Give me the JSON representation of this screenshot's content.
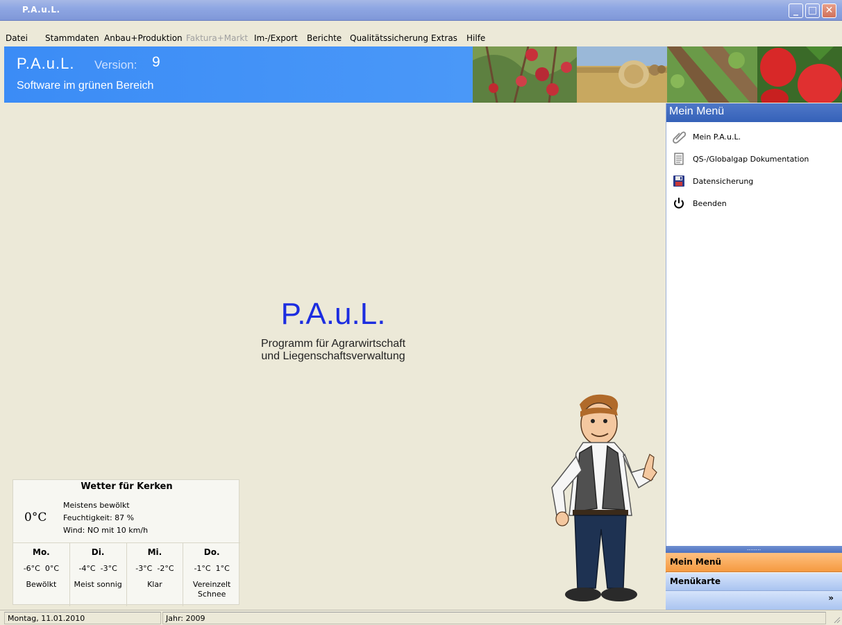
{
  "window": {
    "title": "P.A.u.L."
  },
  "menu": [
    {
      "label": "Datei",
      "enabled": true
    },
    {
      "label": "Stammdaten",
      "enabled": true
    },
    {
      "label": "Anbau+Produktion",
      "enabled": true
    },
    {
      "label": "Faktura+Markt",
      "enabled": false
    },
    {
      "label": "Im-/Export",
      "enabled": true
    },
    {
      "label": "Berichte",
      "enabled": true
    },
    {
      "label": "Qualitätssicherung",
      "enabled": true
    },
    {
      "label": "Extras",
      "enabled": true
    },
    {
      "label": "Hilfe",
      "enabled": true
    }
  ],
  "header": {
    "title": "P.A.u.L.",
    "version_label": "Version:",
    "version_number": "9",
    "subtitle": "Software im grünen Bereich"
  },
  "center": {
    "title": "P.A.u.L.",
    "subtitle_line1": "Programm für Agrarwirtschaft",
    "subtitle_line2": "und Liegenschaftsverwaltung"
  },
  "weather": {
    "title": "Wetter für Kerken",
    "current_temp": "0°C",
    "condition": "Meistens bewölkt",
    "humidity": "Feuchtigkeit: 87 %",
    "wind": "Wind: NO mit 10 km/h",
    "forecast": [
      {
        "day": "Mo.",
        "temps": "-6°C  0°C",
        "cond1": "Bewölkt",
        "cond2": ""
      },
      {
        "day": "Di.",
        "temps": "-4°C  -3°C",
        "cond1": "Meist sonnig",
        "cond2": ""
      },
      {
        "day": "Mi.",
        "temps": "-3°C  -2°C",
        "cond1": "Klar",
        "cond2": ""
      },
      {
        "day": "Do.",
        "temps": "-1°C  1°C",
        "cond1": "Vereinzelt",
        "cond2": "Schnee"
      }
    ]
  },
  "panel": {
    "title": "Mein Menü",
    "items": [
      {
        "label": "Mein P.A.u.L.",
        "icon": "paperclip-icon"
      },
      {
        "label": "QS-/Globalgap Dokumentation",
        "icon": "document-icon"
      },
      {
        "label": "Datensicherung",
        "icon": "floppy-disk-icon"
      },
      {
        "label": "Beenden",
        "icon": "power-icon"
      }
    ],
    "grip": "........",
    "nav_active": "Mein Menü",
    "nav_second": "Menükarte",
    "more_glyph": "»"
  },
  "status": {
    "date": "Montag, 11.01.2010",
    "year": "Jahr: 2009"
  },
  "colors": {
    "header_blue": "#3b8cf6",
    "center_title": "#1c2de0",
    "panel_header": "#3561b8",
    "nav_orange": "#f59a40"
  }
}
